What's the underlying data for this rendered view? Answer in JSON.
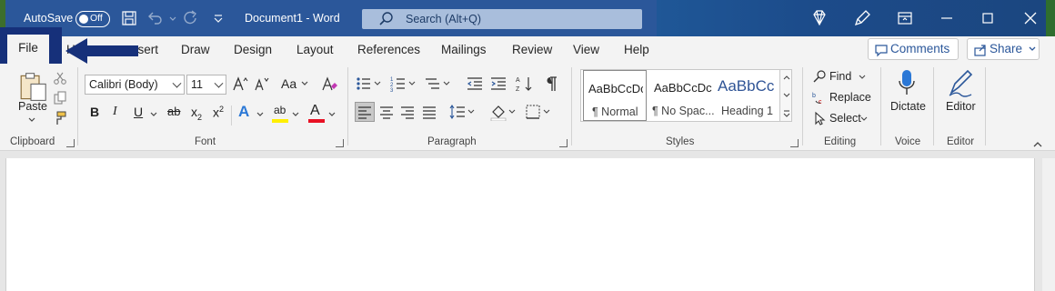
{
  "titlebar": {
    "autosave_label": "AutoSave",
    "autosave_state": "Off",
    "document_title": "Document1  -  Word",
    "search_placeholder": "Search (Alt+Q)"
  },
  "tabs": [
    {
      "label": "File"
    },
    {
      "label": "Home"
    },
    {
      "label": "Insert"
    },
    {
      "label": "Draw"
    },
    {
      "label": "Design"
    },
    {
      "label": "Layout"
    },
    {
      "label": "References"
    },
    {
      "label": "Mailings"
    },
    {
      "label": "Review"
    },
    {
      "label": "View"
    },
    {
      "label": "Help"
    }
  ],
  "tab_visible": {
    "home": "H",
    "insert": "nsert"
  },
  "actions": {
    "comments": "Comments",
    "share": "Share"
  },
  "clipboard": {
    "paste_label": "Paste",
    "group_label": "Clipboard"
  },
  "font": {
    "font_name": "Calibri (Body)",
    "font_size": "11",
    "change_case": "Aa",
    "bold": "B",
    "italic": "I",
    "underline": "U",
    "strikethrough": "ab",
    "subscript_base": "x",
    "subscript_mark": "2",
    "superscript_base": "x",
    "superscript_mark": "2",
    "effects": "A",
    "highlight": "ab",
    "font_color": "A",
    "group_label": "Font",
    "highlight_color": "#ffef00",
    "font_color_value": "#e81123"
  },
  "paragraph": {
    "group_label": "Paragraph"
  },
  "styles": {
    "items": [
      {
        "sample": "AaBbCcDc",
        "name": "¶ Normal"
      },
      {
        "sample": "AaBbCcDc",
        "name": "¶ No Spac..."
      },
      {
        "sample": "AaBbCc",
        "name": "Heading 1"
      }
    ],
    "group_label": "Styles",
    "heading_color": "#2f5496"
  },
  "editing": {
    "find": "Find",
    "replace": "Replace",
    "select": "Select",
    "group_label": "Editing"
  },
  "voice": {
    "dictate": "Dictate",
    "group_label": "Voice"
  },
  "editor": {
    "editor": "Editor",
    "group_label": "Editor"
  },
  "colors": {
    "title_bar": "#2b579a",
    "ribbon": "#f3f3f3",
    "annotation": "#16307a"
  }
}
